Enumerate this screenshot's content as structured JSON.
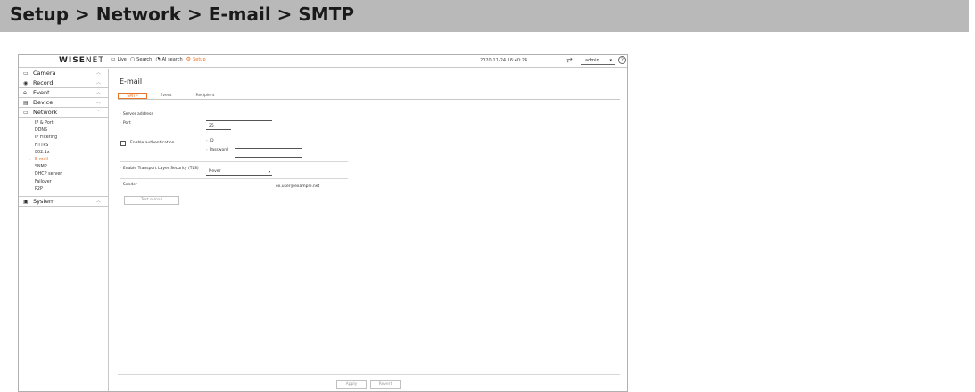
{
  "banner": {
    "title": "Setup > Network > E-mail > SMTP"
  },
  "topbar": {
    "logo_bold": "WISE",
    "logo_thin": "NET",
    "nav": {
      "live": "Live",
      "search": "Search",
      "ai_search": "AI search",
      "setup": "Setup"
    },
    "datetime": "2020-11-24 16:40:24",
    "user": "admin",
    "help": "?"
  },
  "sidebar": {
    "camera": "Camera",
    "record": "Record",
    "event": "Event",
    "device": "Device",
    "network": "Network",
    "network_items": [
      "IP & Port",
      "DDNS",
      "IP Filtering",
      "HTTPS",
      "802.1x",
      "E-mail",
      "SNMP",
      "DHCP server",
      "Failover",
      "P2P"
    ],
    "system": "System"
  },
  "main": {
    "title": "E-mail",
    "tabs": {
      "smtp": "SMTP",
      "event": "Event",
      "recipient": "Recipient"
    },
    "server_address_label": "Server address",
    "server_address_value": "",
    "port_label": "Port",
    "port_value": "25",
    "enable_auth_label": "Enable authentication",
    "id_label": "ID",
    "id_value": "",
    "password_label": "Password",
    "password_value": "",
    "tls_label": "Enable Transport Layer Security (TLS)",
    "tls_value": "Never",
    "sender_label": "Sender",
    "sender_value": "",
    "sender_hint": "ex.user@example.net",
    "test_button": "Test e-mail",
    "apply_button": "Apply",
    "revert_button": "Revert"
  },
  "colors": {
    "accent": "#e8732a",
    "banner": "#b9b9b9"
  },
  "icons": {
    "live": "monitor-icon",
    "search": "search-icon",
    "ai_search": "ai-search-icon",
    "setup": "gear-icon",
    "user": "user-switch-icon",
    "help": "help-icon"
  }
}
